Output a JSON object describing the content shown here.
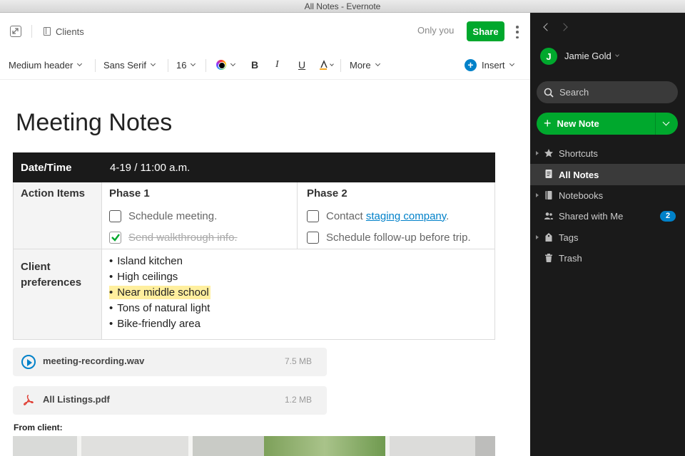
{
  "window": {
    "title": "All Notes - Evernote"
  },
  "topbar": {
    "notebook": "Clients",
    "visibility": "Only you",
    "share_label": "Share"
  },
  "toolbar": {
    "style": "Medium header",
    "font": "Sans Serif",
    "size": "16",
    "bold": "B",
    "italic": "I",
    "underline": "U",
    "more": "More",
    "insert": "Insert"
  },
  "note": {
    "title": "Meeting Notes",
    "datetime_label": "Date/Time",
    "datetime_value": "4-19 / 11:00 a.m.",
    "action_items_label": "Action Items",
    "phase1": {
      "title": "Phase 1",
      "todos": [
        {
          "text": "Schedule meeting.",
          "done": false
        },
        {
          "text": "Send walkthrough info.",
          "done": true
        }
      ]
    },
    "phase2": {
      "title": "Phase 2",
      "todo1_prefix": "Contact ",
      "todo1_link": "staging company",
      "todo1_suffix": ".",
      "todo2": "Schedule follow-up before trip."
    },
    "prefs_label": "Client preferences",
    "preferences": [
      "Island kitchen",
      "High ceilings",
      "Near middle school",
      "Tons of natural light",
      "Bike-friendly area"
    ],
    "highlight_color": "#ffef9e"
  },
  "attachments": [
    {
      "name": "meeting-recording.wav",
      "size": "7.5 MB",
      "icon": "play-icon"
    },
    {
      "name": "All Listings.pdf",
      "size": "1.2 MB",
      "icon": "pdf-icon"
    }
  ],
  "from_client_label": "From client:",
  "sidebar": {
    "user_initial": "J",
    "user_name": "Jamie Gold",
    "search_label": "Search",
    "new_note_label": "New Note",
    "items": [
      {
        "label": "Shortcuts",
        "icon": "star-icon"
      },
      {
        "label": "All Notes",
        "icon": "notes-icon"
      },
      {
        "label": "Notebooks",
        "icon": "notebook-icon"
      },
      {
        "label": "Shared with Me",
        "icon": "people-icon",
        "badge": "2"
      },
      {
        "label": "Tags",
        "icon": "tag-icon"
      },
      {
        "label": "Trash",
        "icon": "trash-icon"
      }
    ]
  },
  "colors": {
    "accent_green": "#00a82d",
    "link_blue": "#0081c9",
    "sidebar_bg": "#1a1a1a"
  }
}
